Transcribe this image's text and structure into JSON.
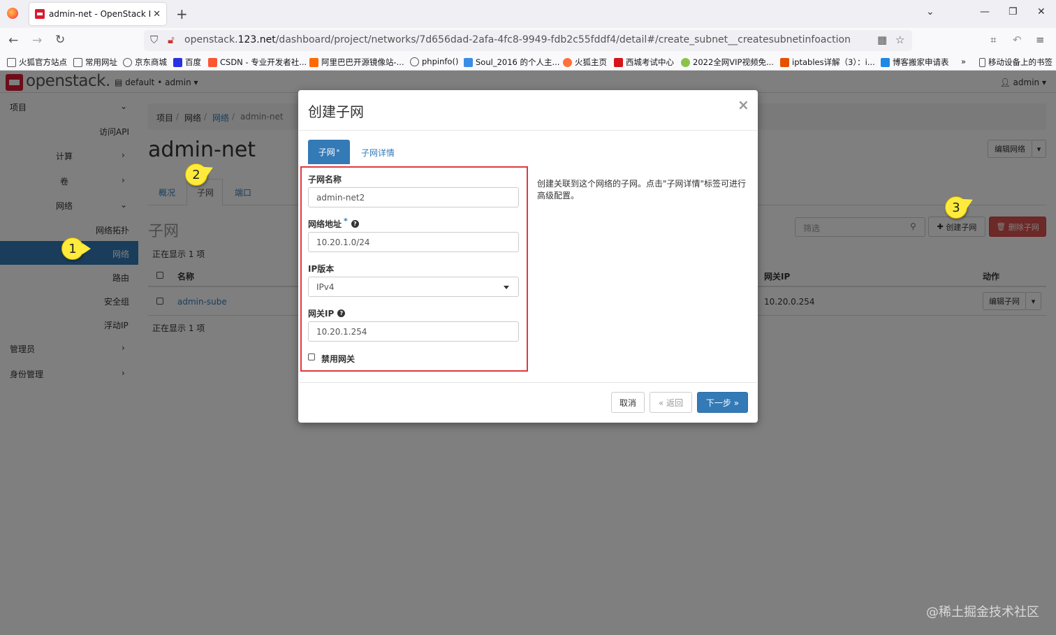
{
  "browser": {
    "tab_title": "admin-net - OpenStack Dash",
    "url_prefix": "openstack.",
    "url_host": "123.net",
    "url_path": "/dashboard/project/networks/7d656dad-2afa-4fc8-9949-fdb2c55fddf4/detail#/create_subnet__createsubnetinfoaction",
    "bookmarks": [
      "火狐官方站点",
      "常用网址",
      "京东商城",
      "百度",
      "CSDN - 专业开发者社...",
      "阿里巴巴开源镜像站-...",
      "phpinfo()",
      "Soul_2016 的个人主...",
      "火狐主页",
      "西城考试中心",
      "2022全网VIP视频免...",
      "iptables详解（3）：i...",
      "博客搬家申请表",
      "移动设备上的书签"
    ]
  },
  "header": {
    "logo": "openstack.",
    "project": "default • admin",
    "user": "admin"
  },
  "sidebar": {
    "project": "项目",
    "api": "访问API",
    "compute": "计算",
    "volume": "卷",
    "network": "网络",
    "topology": "网络拓扑",
    "networks": "网络",
    "routers": "路由",
    "security_groups": "安全组",
    "floating_ip": "浮动IP",
    "admin": "管理员",
    "identity": "身份管理"
  },
  "page": {
    "breadcrumb": [
      "项目",
      "网络",
      "网络",
      "admin-net"
    ],
    "title": "admin-net",
    "tabs": [
      "概况",
      "子网",
      "端口"
    ],
    "section": "子网",
    "filter_placeholder": "筛选",
    "create_subnet": "创建子网",
    "delete_subnet": "删除子网",
    "edit_network": "编辑网络",
    "showing_top": "正在显示 1 项",
    "showing_bottom": "正在显示 1 项",
    "col_name": "名称",
    "col_gateway": "网关IP",
    "col_actions": "动作",
    "row_name": "admin-sube",
    "row_gateway": "10.20.0.254",
    "row_edit": "编辑子网"
  },
  "modal": {
    "title": "创建子网",
    "tab_subnet": "子网",
    "tab_details": "子网详情",
    "label_name": "子网名称",
    "value_name": "admin-net2",
    "label_address": "网络地址",
    "value_address": "10.20.1.0/24",
    "label_ipversion": "IP版本",
    "value_ipversion": "IPv4",
    "label_gateway": "网关IP",
    "value_gateway": "10.20.1.254",
    "label_disable_gateway": "禁用网关",
    "help_text": "创建关联到这个网络的子网。点击\"子网详情\"标签可进行高级配置。",
    "btn_cancel": "取消",
    "btn_back": "« 返回",
    "btn_next": "下一步 »"
  },
  "callouts": [
    "1",
    "2",
    "3"
  ],
  "watermark": "@稀土掘金技术社区"
}
